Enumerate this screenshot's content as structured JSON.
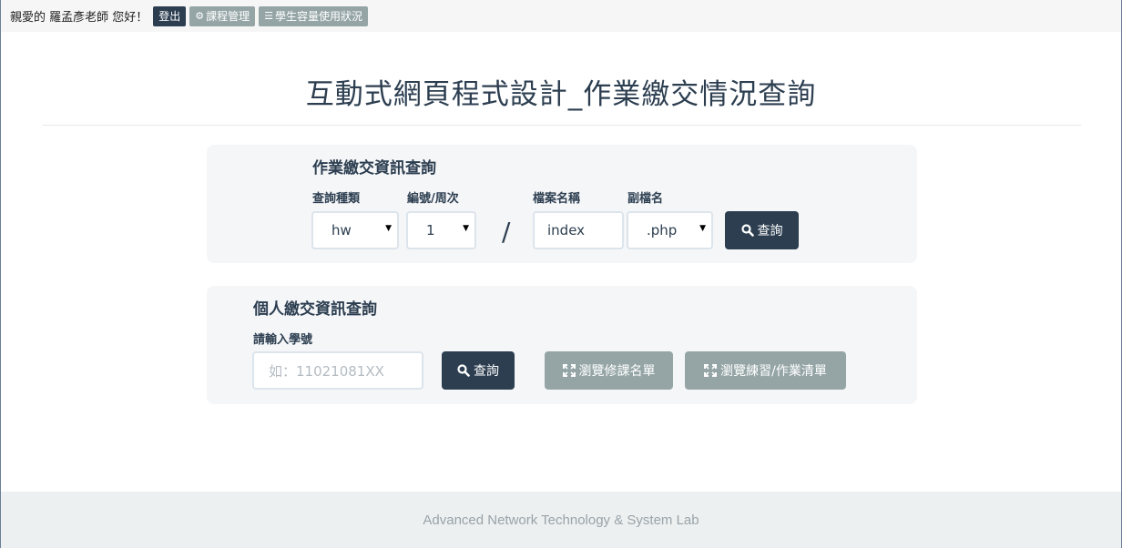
{
  "topbar": {
    "greeting": "親愛的 羅孟彥老師 您好！",
    "logout_label": "登出",
    "course_manage_label": "課程管理",
    "storage_label": "學生容量使用狀況"
  },
  "page_title": "互動式網頁程式設計_作業繳交情況查詢",
  "homework_query": {
    "heading": "作業繳交資訊查詢",
    "type_label": "查詢種類",
    "type_value": "hw",
    "number_label": "編號/周次",
    "number_value": "1",
    "separator": "/",
    "filename_label": "檔案名稱",
    "filename_value": "index",
    "ext_label": "副檔名",
    "ext_value": ".php",
    "search_label": "查詢"
  },
  "personal_query": {
    "heading": "個人繳交資訊查詢",
    "student_id_label": "請輸入學號",
    "student_id_placeholder": "如：11021081XX",
    "search_label": "查詢",
    "roster_label": "瀏覽修課名單",
    "assignments_label": "瀏覽練習/作業清單"
  },
  "footer": {
    "text": "Advanced Network Technology & System Lab"
  },
  "colors": {
    "primary": "#2c3e50",
    "secondary": "#95a5a6",
    "panel_bg": "#f5f6f8",
    "footer_bg": "#ecf0f1"
  },
  "icons": {
    "course_manage": "gear-icon",
    "storage": "list-icon",
    "search": "search-icon",
    "expand": "expand-icon"
  }
}
